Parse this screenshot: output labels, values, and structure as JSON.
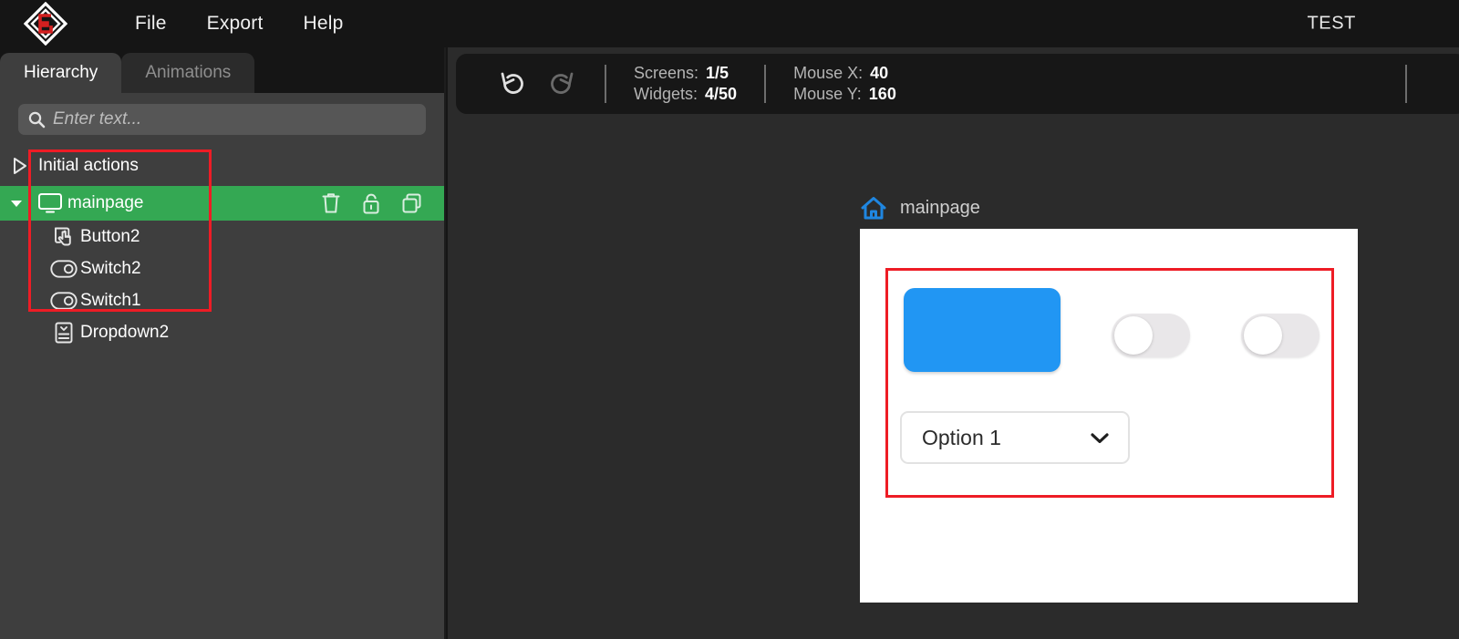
{
  "app": {
    "logo_icon": "diamond-s-logo",
    "accent_green": "#34a853",
    "accent_red": "#ee1c25",
    "accent_blue": "#2196f3",
    "test_label": "TEST"
  },
  "menubar": {
    "items": [
      {
        "label": "File",
        "name": "menu-file"
      },
      {
        "label": "Export",
        "name": "menu-export"
      },
      {
        "label": "Help",
        "name": "menu-help"
      }
    ]
  },
  "sidebar": {
    "tabs": [
      {
        "label": "Hierarchy",
        "active": true
      },
      {
        "label": "Animations",
        "active": false
      }
    ],
    "search": {
      "placeholder": "Enter text...",
      "value": "",
      "icon": "search-icon"
    },
    "tree": [
      {
        "label": "Initial actions",
        "icon": "play-triangle-icon",
        "level": 0,
        "selected": false
      },
      {
        "label": "mainpage",
        "icon": "screen-icon",
        "level": 0,
        "selected": true,
        "actions": [
          {
            "label": "Delete",
            "icon": "trash-icon"
          },
          {
            "label": "Lock",
            "icon": "unlock-icon"
          },
          {
            "label": "Duplicate",
            "icon": "copy-icon"
          }
        ]
      },
      {
        "label": "Button2",
        "icon": "button-hand-icon",
        "level": 1,
        "selected": false
      },
      {
        "label": "Switch2",
        "icon": "switch-icon",
        "level": 1,
        "selected": false
      },
      {
        "label": "Switch1",
        "icon": "switch-icon",
        "level": 1,
        "selected": false
      },
      {
        "label": "Dropdown2",
        "icon": "dropdown-icon",
        "level": 1,
        "selected": false
      }
    ]
  },
  "statusbar": {
    "undo_icon": "undo-icon",
    "redo_icon": "redo-icon",
    "screens_label": "Screens:",
    "screens_value": "1/5",
    "widgets_label": "Widgets:",
    "widgets_value": "4/50",
    "mouse_x_label": "Mouse X:",
    "mouse_x_value": "40",
    "mouse_y_label": "Mouse Y:",
    "mouse_y_value": "160"
  },
  "canvas": {
    "page_icon": "home-icon",
    "page_title": "mainpage",
    "widgets": {
      "button_label": "",
      "dropdown_value": "Option 1",
      "dropdown_icon": "chevron-down-icon",
      "switch2_on": false,
      "switch1_on": false
    }
  }
}
